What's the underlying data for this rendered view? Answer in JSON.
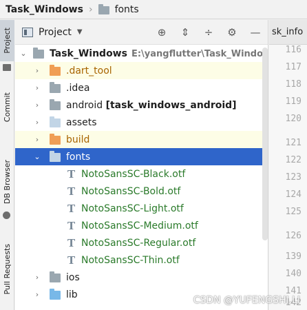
{
  "breadcrumb": {
    "project": "Task_Windows",
    "folder": "fonts"
  },
  "stripe": {
    "tabs": [
      "Project",
      "Commit",
      "DB Browser",
      "Pull Requests"
    ]
  },
  "panel": {
    "title": "Project"
  },
  "tree": {
    "root": {
      "name": "Task_Windows",
      "path": "E:\\yangflutter\\Task_Windows"
    },
    "items": [
      {
        "label": ".dart_tool"
      },
      {
        "label": ".idea"
      },
      {
        "label": "android",
        "suffix": "[task_windows_android]"
      },
      {
        "label": "assets"
      },
      {
        "label": "build"
      },
      {
        "label": "fonts"
      },
      {
        "label": "NotoSansSC-Black.otf"
      },
      {
        "label": "NotoSansSC-Bold.otf"
      },
      {
        "label": "NotoSansSC-Light.otf"
      },
      {
        "label": "NotoSansSC-Medium.otf"
      },
      {
        "label": "NotoSansSC-Regular.otf"
      },
      {
        "label": "NotoSansSC-Thin.otf"
      },
      {
        "label": "ios"
      },
      {
        "label": "lib"
      }
    ]
  },
  "editor": {
    "tab_label": "sk_info",
    "lines": [
      "116",
      "117",
      "118",
      "119",
      "120",
      "121",
      "122",
      "123",
      "124",
      "125",
      "126",
      "139",
      "140",
      "141",
      "142"
    ]
  },
  "watermark": "CSDN @YUFENGSHI.LI"
}
